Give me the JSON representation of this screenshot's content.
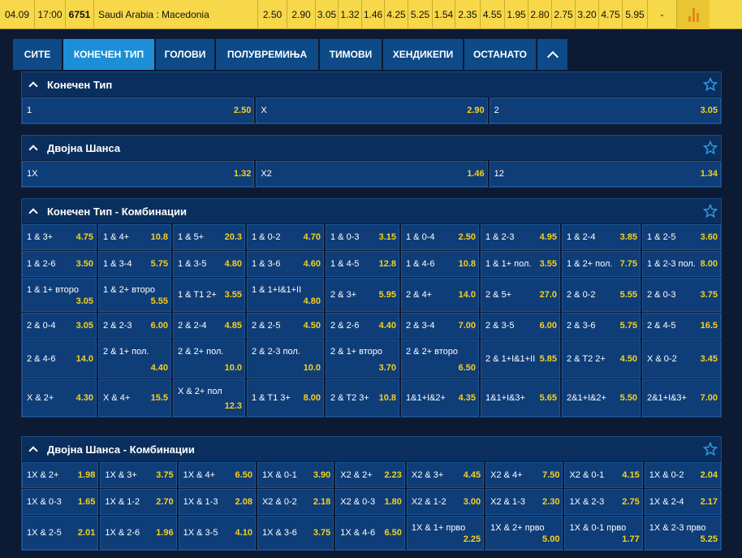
{
  "colors": {
    "accent_tab": "#1c8fd6",
    "tab": "#0d4a87",
    "odds": "#f5d020",
    "topbar": "#f7d84a"
  },
  "topbar": {
    "date": "04.09",
    "time": "17:00",
    "code": "6751",
    "match": "Saudi Arabia : Macedonia",
    "odds": [
      "2.50",
      "2.90",
      "3.05",
      "1.32",
      "1.46",
      "4.25",
      "5.25",
      "1.54",
      "2.35",
      "4.55",
      "1.95",
      "2.80",
      "2.75",
      "3.20",
      "4.75",
      "5.95"
    ],
    "extra": "-",
    "chart_icon": "bar-chart-icon"
  },
  "tabs": [
    "СИТЕ",
    "КОНЕЧЕН ТИП",
    "ГОЛОВИ",
    "ПОЛУВРЕМИЊА",
    "ТИМОВИ",
    "ХЕНДИКЕПИ",
    "ОСТАНАТО"
  ],
  "active_tab": 1,
  "sections": [
    {
      "title": "Конечен Тип",
      "rows": [
        {
          "cells": [
            {
              "label": "1",
              "odd": "2.50"
            },
            {
              "label": "X",
              "odd": "2.90"
            },
            {
              "label": "2",
              "odd": "3.05"
            }
          ]
        }
      ]
    },
    {
      "title": "Двојна Шанса",
      "rows": [
        {
          "cells": [
            {
              "label": "1X",
              "odd": "1.32"
            },
            {
              "label": "X2",
              "odd": "1.46"
            },
            {
              "label": "12",
              "odd": "1.34"
            }
          ]
        }
      ]
    },
    {
      "title": "Конечен Тип - Комбинации",
      "rows": [
        {
          "cells": [
            {
              "label": "1 & 3+",
              "odd": "4.75"
            },
            {
              "label": "1 & 4+",
              "odd": "10.8"
            },
            {
              "label": "1 & 5+",
              "odd": "20.3"
            },
            {
              "label": "1 & 0-2",
              "odd": "4.70"
            },
            {
              "label": "1 & 0-3",
              "odd": "3.15"
            },
            {
              "label": "1 & 0-4",
              "odd": "2.50"
            },
            {
              "label": "1 & 2-3",
              "odd": "4.95"
            },
            {
              "label": "1 & 2-4",
              "odd": "3.85"
            },
            {
              "label": "1 & 2-5",
              "odd": "3.60"
            }
          ]
        },
        {
          "cells": [
            {
              "label": "1 & 2-6",
              "odd": "3.50"
            },
            {
              "label": "1 & 3-4",
              "odd": "5.75"
            },
            {
              "label": "1 & 3-5",
              "odd": "4.80"
            },
            {
              "label": "1 & 3-6",
              "odd": "4.60"
            },
            {
              "label": "1 & 4-5",
              "odd": "12.8"
            },
            {
              "label": "1 & 4-6",
              "odd": "10.8"
            },
            {
              "label": "1 & 1+ пол.",
              "odd": "3.55"
            },
            {
              "label": "1 & 2+ пол.",
              "odd": "7.75"
            },
            {
              "label": "1 & 2-3 пол.",
              "odd": "8.00"
            }
          ]
        },
        {
          "cells": [
            {
              "label": "1 & 1+ второ",
              "odd": "3.05",
              "two": true
            },
            {
              "label": "1 & 2+ второ",
              "odd": "5.55",
              "two": true
            },
            {
              "label": "1 & T1 2+",
              "odd": "3.55"
            },
            {
              "label": "1 & 1+I&1+II",
              "odd": "4.80",
              "two": true
            },
            {
              "label": "2 & 3+",
              "odd": "5.95"
            },
            {
              "label": "2 & 4+",
              "odd": "14.0"
            },
            {
              "label": "2 & 5+",
              "odd": "27.0"
            },
            {
              "label": "2 & 0-2",
              "odd": "5.55"
            },
            {
              "label": "2 & 0-3",
              "odd": "3.75"
            }
          ]
        },
        {
          "cells": [
            {
              "label": "2 & 0-4",
              "odd": "3.05"
            },
            {
              "label": "2 & 2-3",
              "odd": "6.00"
            },
            {
              "label": "2 & 2-4",
              "odd": "4.85"
            },
            {
              "label": "2 & 2-5",
              "odd": "4.50"
            },
            {
              "label": "2 & 2-6",
              "odd": "4.40"
            },
            {
              "label": "2 & 3-4",
              "odd": "7.00"
            },
            {
              "label": "2 & 3-5",
              "odd": "6.00"
            },
            {
              "label": "2 & 3-6",
              "odd": "5.75"
            },
            {
              "label": "2 & 4-5",
              "odd": "16.5"
            }
          ]
        },
        {
          "cells": [
            {
              "label": "2 & 4-6",
              "odd": "14.0"
            },
            {
              "label": "2 & 1+ пол.",
              "odd": "4.40",
              "two": true
            },
            {
              "label": "2 & 2+ пол.",
              "odd": "10.0",
              "two": true
            },
            {
              "label": "2 & 2-3 пол.",
              "odd": "10.0",
              "two": true
            },
            {
              "label": "2 & 1+ второ",
              "odd": "3.70",
              "two": true
            },
            {
              "label": "2 & 2+ второ",
              "odd": "6.50",
              "two": true
            },
            {
              "label": "2 & 1+I&1+II",
              "odd": "5.85"
            },
            {
              "label": "2 & T2 2+",
              "odd": "4.50"
            },
            {
              "label": "X & 0-2",
              "odd": "3.45"
            }
          ]
        },
        {
          "cells": [
            {
              "label": "X & 2+",
              "odd": "4.30"
            },
            {
              "label": "X & 4+",
              "odd": "15.5"
            },
            {
              "label": "X & 2+ пол",
              "odd": "12.3",
              "two": true
            },
            {
              "label": "1 & T1 3+",
              "odd": "8.00"
            },
            {
              "label": "2 & T2 3+",
              "odd": "10.8"
            },
            {
              "label": "1&1+I&2+",
              "odd": "4.35"
            },
            {
              "label": "1&1+I&3+",
              "odd": "5.65"
            },
            {
              "label": "2&1+I&2+",
              "odd": "5.50"
            },
            {
              "label": "2&1+I&3+",
              "odd": "7.00"
            }
          ]
        }
      ]
    },
    {
      "title": "Двојна Шанса - Комбинации",
      "rows": [
        {
          "cells": [
            {
              "label": "1X & 2+",
              "odd": "1.98"
            },
            {
              "label": "1X & 3+",
              "odd": "3.75"
            },
            {
              "label": "1X & 4+",
              "odd": "6.50"
            },
            {
              "label": "1X & 0-1",
              "odd": "3.90"
            },
            {
              "label": "X2 & 2+",
              "odd": "2.23"
            },
            {
              "label": "X2 & 3+",
              "odd": "4.45"
            },
            {
              "label": "X2 & 4+",
              "odd": "7.50"
            },
            {
              "label": "X2 & 0-1",
              "odd": "4.15"
            },
            {
              "label": "1X & 0-2",
              "odd": "2.04"
            }
          ]
        },
        {
          "cells": [
            {
              "label": "1X & 0-3",
              "odd": "1.65"
            },
            {
              "label": "1X & 1-2",
              "odd": "2.70"
            },
            {
              "label": "1X & 1-3",
              "odd": "2.08"
            },
            {
              "label": "X2 & 0-2",
              "odd": "2.18"
            },
            {
              "label": "X2 & 0-3",
              "odd": "1.80"
            },
            {
              "label": "X2 & 1-2",
              "odd": "3.00"
            },
            {
              "label": "X2 & 1-3",
              "odd": "2.30"
            },
            {
              "label": "1X & 2-3",
              "odd": "2.75"
            },
            {
              "label": "1X & 2-4",
              "odd": "2.17"
            }
          ]
        },
        {
          "cells": [
            {
              "label": "1X & 2-5",
              "odd": "2.01"
            },
            {
              "label": "1X & 2-6",
              "odd": "1.96"
            },
            {
              "label": "1X & 3-5",
              "odd": "4.10"
            },
            {
              "label": "1X & 3-6",
              "odd": "3.75"
            },
            {
              "label": "1X & 4-6",
              "odd": "6.50"
            },
            {
              "label": "1X & 1+ прво",
              "odd": "2.25",
              "two": true
            },
            {
              "label": "1X & 2+ прво",
              "odd": "5.00",
              "two": true
            },
            {
              "label": "1X & 0-1 прво",
              "odd": "1.77",
              "two": true
            },
            {
              "label": "1X & 2-3 прво",
              "odd": "5.25",
              "two": true
            }
          ]
        }
      ]
    }
  ]
}
